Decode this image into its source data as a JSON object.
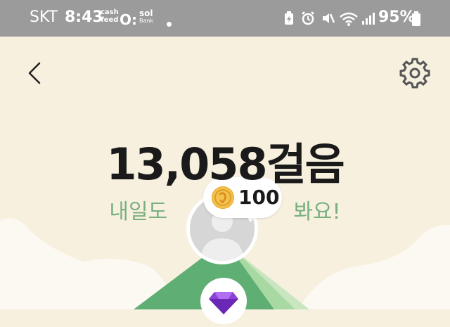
{
  "status_bar": {
    "carrier": "SKT",
    "time": "8:43",
    "notification_icons": [
      {
        "line1": "cash",
        "line2": "feed"
      },
      {
        "text": "O:"
      },
      {
        "line1": "sol",
        "line2": "Bank"
      }
    ],
    "battery_percent": "95%"
  },
  "header": {
    "back_icon": "chevron-left-icon",
    "settings_icon": "gear-icon"
  },
  "main": {
    "steps_text": "13,058걸음",
    "cheer_left": "내일도",
    "cheer_right": "봐요!",
    "reward_amount": "100",
    "reward_icon": "coin-icon",
    "avatar_icon": "profile-placeholder-icon",
    "gem_icon": "gem-icon"
  },
  "colors": {
    "background": "#f7f0df",
    "status_bar": "#9b9b9b",
    "accent_green": "#78b07e",
    "coin": "#f2c14e",
    "gem": "#8b43d6"
  }
}
